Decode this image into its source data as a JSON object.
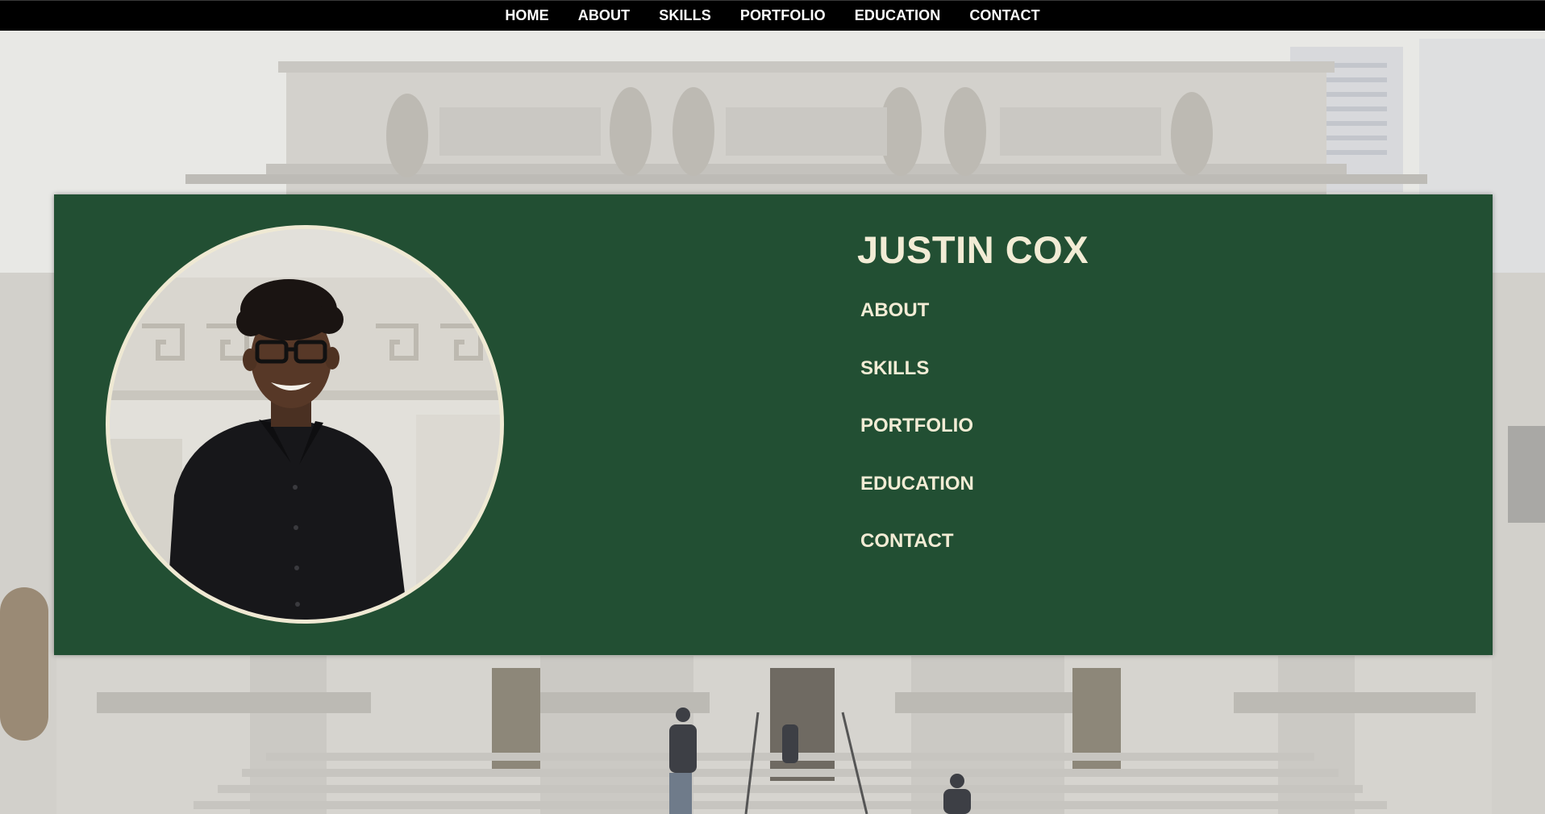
{
  "top_nav": {
    "items": [
      {
        "label": "HOME"
      },
      {
        "label": "ABOUT"
      },
      {
        "label": "SKILLS"
      },
      {
        "label": "PORTFOLIO"
      },
      {
        "label": "EDUCATION"
      },
      {
        "label": "CONTACT"
      }
    ]
  },
  "hero": {
    "name": "JUSTIN COX",
    "menu": [
      {
        "label": "ABOUT"
      },
      {
        "label": "SKILLS"
      },
      {
        "label": "PORTFOLIO"
      },
      {
        "label": "EDUCATION"
      },
      {
        "label": "CONTACT"
      }
    ]
  },
  "colors": {
    "nav_background": "#000000",
    "nav_text": "#ffffff",
    "panel_background": "#224f33",
    "panel_text": "#f2ecd5",
    "portrait_border": "#efe9d3"
  }
}
